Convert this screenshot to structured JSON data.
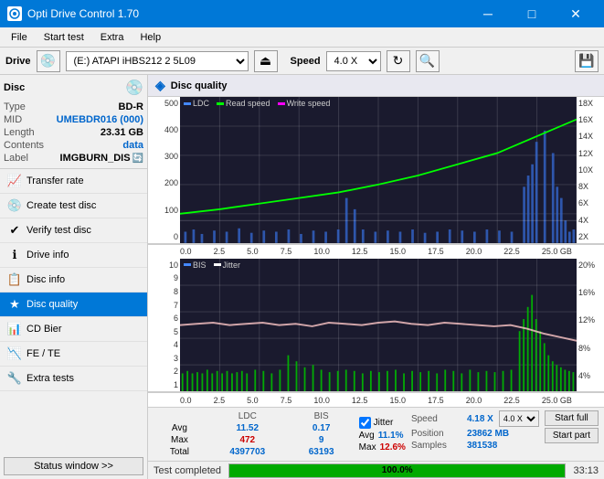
{
  "titlebar": {
    "title": "Opti Drive Control 1.70",
    "icon": "disc",
    "min_btn": "─",
    "max_btn": "□",
    "close_btn": "✕"
  },
  "menu": {
    "items": [
      "File",
      "Start test",
      "Extra",
      "Help"
    ]
  },
  "drive_bar": {
    "label": "Drive",
    "drive_value": "(E:)  ATAPI iHBS212  2 5L09",
    "speed_label": "Speed",
    "speed_value": "4.0 X"
  },
  "disc": {
    "title": "Disc",
    "type_label": "Type",
    "type_val": "BD-R",
    "mid_label": "MID",
    "mid_val": "UMEBDR016 (000)",
    "length_label": "Length",
    "length_val": "23.31 GB",
    "contents_label": "Contents",
    "contents_val": "data",
    "label_label": "Label",
    "label_val": "IMGBURN_DIS"
  },
  "nav": [
    {
      "id": "transfer-rate",
      "label": "Transfer rate",
      "icon": "📈"
    },
    {
      "id": "create-test-disc",
      "label": "Create test disc",
      "icon": "💿"
    },
    {
      "id": "verify-test-disc",
      "label": "Verify test disc",
      "icon": "✔"
    },
    {
      "id": "drive-info",
      "label": "Drive info",
      "icon": "ℹ"
    },
    {
      "id": "disc-info",
      "label": "Disc info",
      "icon": "📋"
    },
    {
      "id": "disc-quality",
      "label": "Disc quality",
      "icon": "★",
      "active": true
    },
    {
      "id": "cd-bier",
      "label": "CD Bier",
      "icon": "📊"
    },
    {
      "id": "fe-te",
      "label": "FE / TE",
      "icon": "📉"
    },
    {
      "id": "extra-tests",
      "label": "Extra tests",
      "icon": "🔧"
    }
  ],
  "status_btn": "Status window >>",
  "chart": {
    "title": "Disc quality",
    "top_chart": {
      "legend": [
        {
          "label": "LDC",
          "color": "#4488ff"
        },
        {
          "label": "Read speed",
          "color": "#00ff00"
        },
        {
          "label": "Write speed",
          "color": "#ff00ff"
        }
      ],
      "y_left": [
        "500",
        "400",
        "300",
        "200",
        "100",
        "0"
      ],
      "y_right": [
        "18X",
        "16X",
        "14X",
        "12X",
        "10X",
        "8X",
        "6X",
        "4X",
        "2X"
      ],
      "x_axis": [
        "0.0",
        "2.5",
        "5.0",
        "7.5",
        "10.0",
        "12.5",
        "15.0",
        "17.5",
        "20.0",
        "22.5",
        "25.0 GB"
      ]
    },
    "bottom_chart": {
      "legend": [
        {
          "label": "BIS",
          "color": "#4488ff"
        },
        {
          "label": "Jitter",
          "color": "#ffffff"
        }
      ],
      "y_left": [
        "10",
        "9",
        "8",
        "7",
        "6",
        "5",
        "4",
        "3",
        "2",
        "1"
      ],
      "y_right": [
        "20%",
        "16%",
        "12%",
        "8%",
        "4%"
      ],
      "x_axis": [
        "0.0",
        "2.5",
        "5.0",
        "7.5",
        "10.0",
        "12.5",
        "15.0",
        "17.5",
        "20.0",
        "22.5",
        "25.0 GB"
      ]
    }
  },
  "stats": {
    "col_ldc": "LDC",
    "col_bis": "BIS",
    "row_avg": "Avg",
    "row_max": "Max",
    "row_total": "Total",
    "ldc_avg": "11.52",
    "ldc_max": "472",
    "ldc_total": "4397703",
    "bis_avg": "0.17",
    "bis_max": "9",
    "bis_total": "63193",
    "jitter_label": "Jitter",
    "jitter_avg": "11.1%",
    "jitter_max": "12.6%",
    "speed_label": "Speed",
    "speed_val": "4.18 X",
    "position_label": "Position",
    "position_val": "23862 MB",
    "samples_label": "Samples",
    "samples_val": "381538",
    "btn_start_full": "Start full",
    "btn_start_part": "Start part",
    "speed_dropdown": "4.0 X"
  },
  "bottom": {
    "status": "Test completed",
    "progress": "100.0%",
    "time": "33:13"
  }
}
